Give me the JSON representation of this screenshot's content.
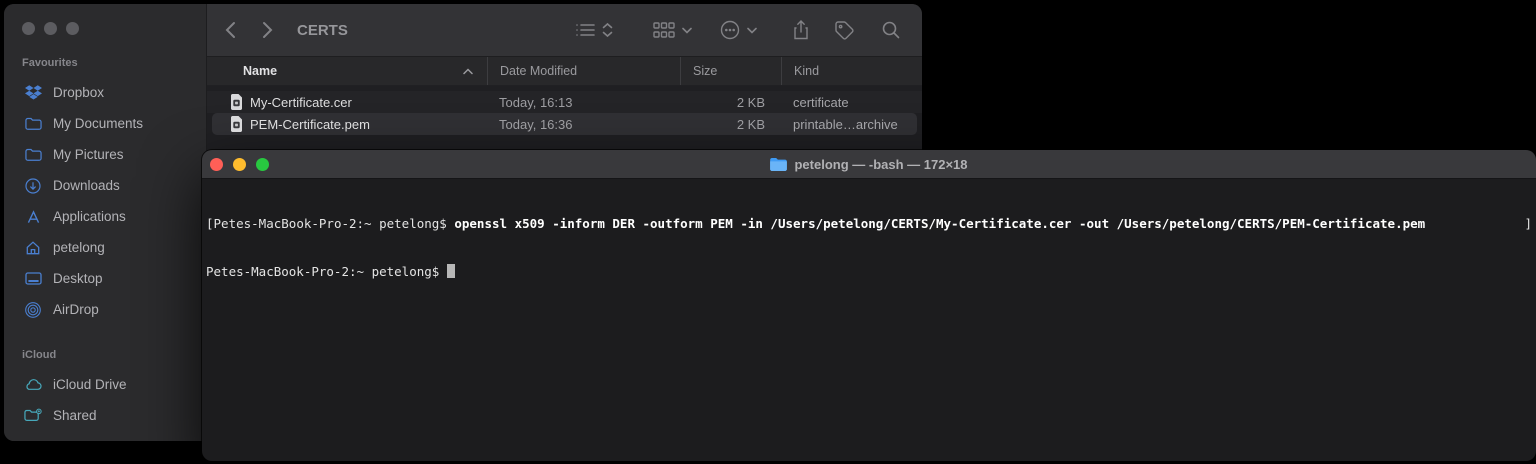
{
  "finder": {
    "toolbar": {
      "title": "CERTS"
    },
    "sidebar": {
      "sections": [
        {
          "title": "Favourites",
          "items": [
            {
              "label": "Dropbox"
            },
            {
              "label": "My Documents"
            },
            {
              "label": "My Pictures"
            },
            {
              "label": "Downloads"
            },
            {
              "label": "Applications"
            },
            {
              "label": "petelong"
            },
            {
              "label": "Desktop"
            },
            {
              "label": "AirDrop"
            }
          ]
        },
        {
          "title": "iCloud",
          "items": [
            {
              "label": "iCloud Drive"
            },
            {
              "label": "Shared"
            }
          ]
        }
      ]
    },
    "list": {
      "columns": [
        "Name",
        "Date Modified",
        "Size",
        "Kind"
      ],
      "rows": [
        {
          "name": "My-Certificate.cer",
          "date_modified": "Today, 16:13",
          "size": "2 KB",
          "kind": "certificate"
        },
        {
          "name": "PEM-Certificate.pem",
          "date_modified": "Today, 16:36",
          "size": "2 KB",
          "kind": "printable…archive"
        }
      ]
    }
  },
  "terminal": {
    "title": "petelong — -bash — 172×18",
    "line1": {
      "bracket_open": "[",
      "prompt": "Petes-MacBook-Pro-2:~ petelong$ ",
      "command": "openssl x509 -inform DER -outform PEM -in /Users/petelong/CERTS/My-Certificate.cer -out /Users/petelong/CERTS/PEM-Certificate.pem",
      "bracket_close": "]"
    },
    "line2": {
      "prompt": "Petes-MacBook-Pro-2:~ petelong$ "
    }
  },
  "colors": {
    "sidebar_icon_blue": "#4a7fd0",
    "icloud_icon_teal": "#47a8ba",
    "traffic_red": "#ff5f57",
    "traffic_yellow": "#febc2e",
    "traffic_green": "#28c840",
    "inactive_dot_gray": "#5c5c60",
    "terminal_bg": "#1c1c1e",
    "finder_bg": "#29292b"
  }
}
